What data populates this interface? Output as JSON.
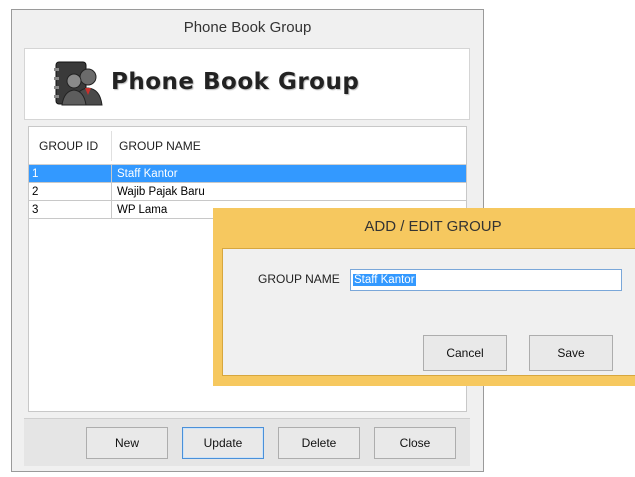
{
  "window": {
    "title": "Phone Book Group",
    "banner_text": "Phone Book Group",
    "banner_icon": "phone-book-people-icon"
  },
  "table": {
    "columns": [
      "GROUP ID",
      "GROUP NAME"
    ],
    "rows": [
      {
        "id": "1",
        "name": "Staff Kantor",
        "selected": true
      },
      {
        "id": "2",
        "name": "Wajib Pajak Baru",
        "selected": false
      },
      {
        "id": "3",
        "name": "WP Lama",
        "selected": false
      }
    ]
  },
  "buttons": {
    "new": "New",
    "update": "Update",
    "delete": "Delete",
    "close": "Close"
  },
  "dialog": {
    "title": "ADD / EDIT GROUP",
    "group_name_label": "GROUP NAME",
    "group_name_value": "Staff Kantor",
    "cancel": "Cancel",
    "save": "Save",
    "accent_color": "#f6c85f"
  },
  "colors": {
    "selection": "#3399ff"
  }
}
